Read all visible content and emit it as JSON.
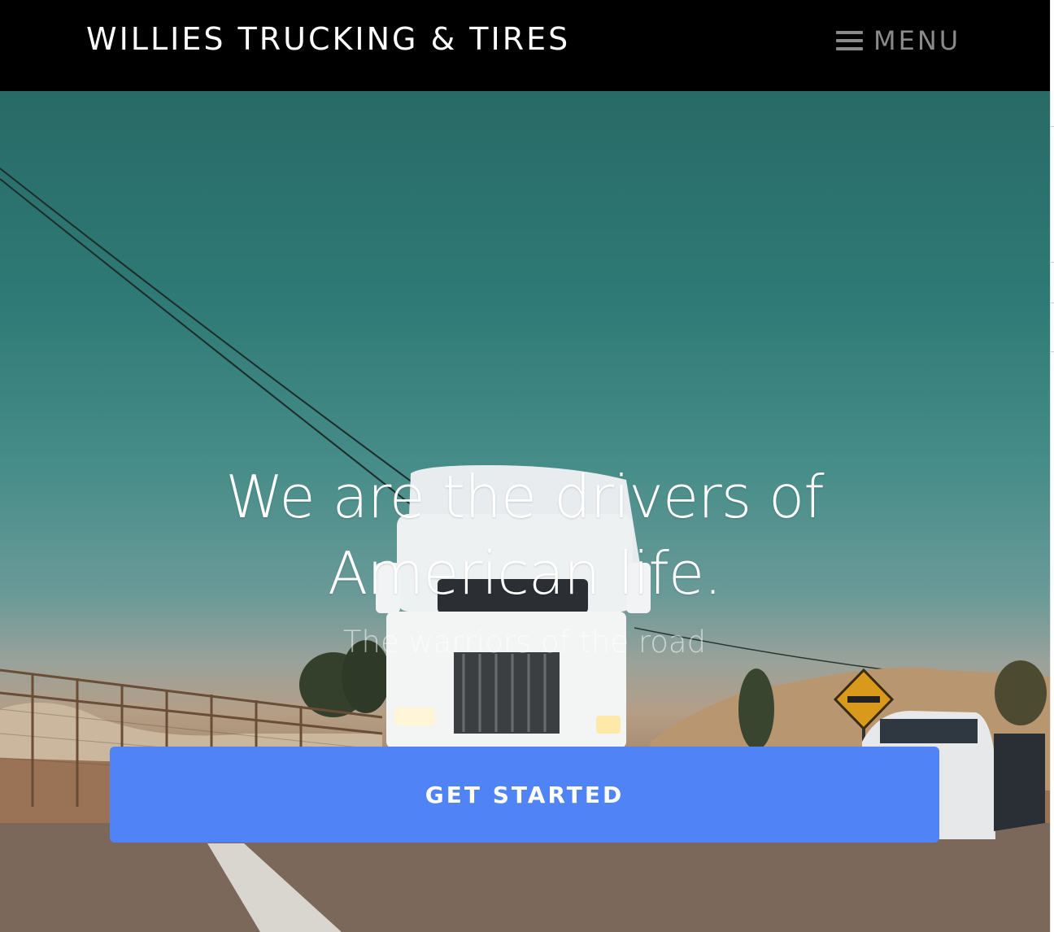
{
  "navbar": {
    "brand": "WILLIES TRUCKING & TIRES",
    "menu_label": "MENU",
    "menu_icon": "hamburger-icon"
  },
  "hero": {
    "headline_line1": "We are the drivers of",
    "headline_line2": "American life.",
    "subheadline": "The warriors of the road",
    "cta_label": "GET STARTED",
    "background_image": "white semi truck driving down a desert road under a teal sky"
  },
  "colors": {
    "navbar_bg": "#000000",
    "brand_text": "#ffffff",
    "menu_text": "#8a8a8a",
    "cta_bg": "#5083f5",
    "sky": "#2f7a76"
  }
}
